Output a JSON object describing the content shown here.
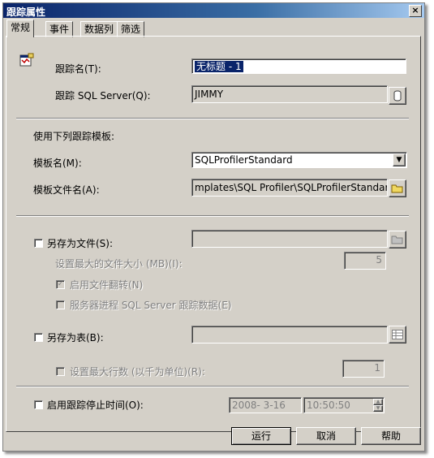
{
  "window": {
    "title": "跟踪属性",
    "close": "×"
  },
  "tabs": [
    {
      "label": "常规"
    },
    {
      "label": "事件"
    },
    {
      "label": "数据列"
    },
    {
      "label": "筛选"
    }
  ],
  "general": {
    "trace_name_label": "跟踪名(T):",
    "trace_name_value": "无标题 - 1",
    "server_label": "跟踪 SQL Server(Q):",
    "server_value": "JIMMY",
    "template_heading": "使用下列跟踪模板:",
    "template_name_label": "模板名(M):",
    "template_name_value": "SQLProfilerStandard",
    "template_file_label": "模板文件名(A):",
    "template_file_value": "mplates\\SQL Profiler\\SQLProfilerStandard.tdf",
    "save_file_label": "另存为文件(S):",
    "save_file_value": "",
    "max_size_label": "设置最大的文件大小 (MB)(I):",
    "max_size_value": "5",
    "rollover_label": "启用文件翻转(N)",
    "rollover_checked": true,
    "server_process_label": "服务器进程 SQL Server 跟踪数据(E)",
    "save_table_label": "另存为表(B):",
    "save_table_value": "",
    "max_rows_label": "设置最大行数 (以千为单位)(R):",
    "max_rows_value": "1",
    "stop_time_label": "启用跟踪停止时间(O):",
    "stop_date": "2008- 3-16",
    "stop_time": "10:50:50"
  },
  "buttons": {
    "run": "运行",
    "cancel": "取消",
    "help": "帮助"
  }
}
